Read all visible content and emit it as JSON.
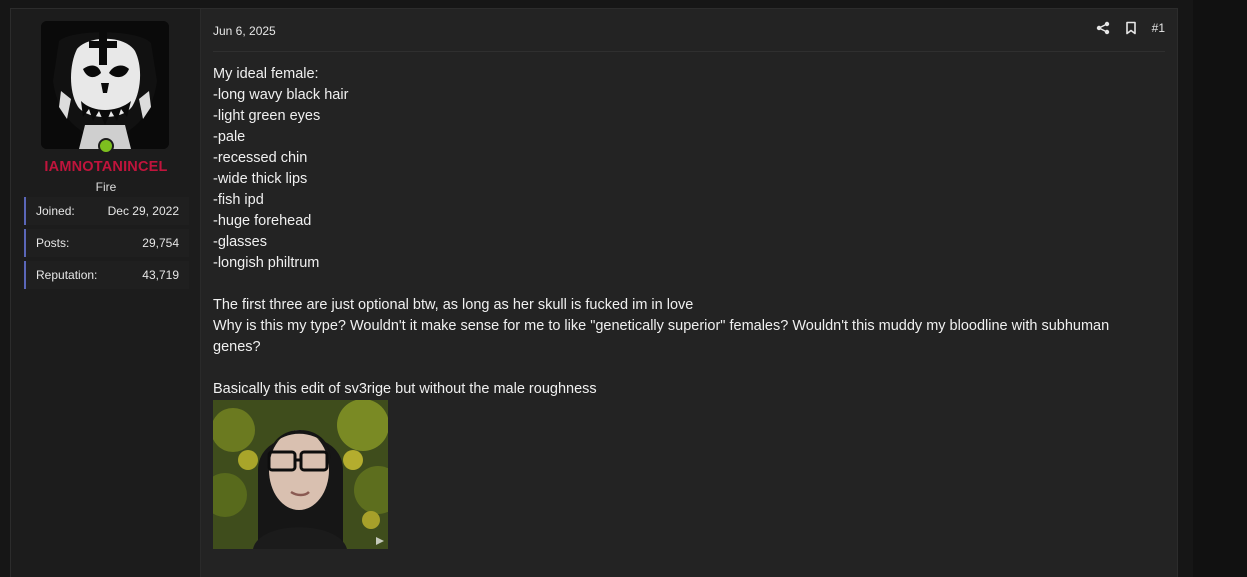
{
  "user": {
    "name": "IAMNOTANINCEL",
    "title": "Fire",
    "stats": [
      {
        "label": "Joined:",
        "value": "Dec 29, 2022"
      },
      {
        "label": "Posts:",
        "value": "29,754"
      },
      {
        "label": "Reputation:",
        "value": "43,719"
      }
    ],
    "status_color": "#7dbf1f",
    "name_color": "#c0143c"
  },
  "post": {
    "date": "Jun 6, 2025",
    "number": "#1",
    "icons": [
      "share-icon",
      "bookmark-icon"
    ],
    "body_lines": [
      "My ideal female:",
      "-long wavy black hair",
      "-light green eyes",
      "-pale",
      "-recessed chin",
      "-wide thick lips",
      "-fish ipd",
      "-huge forehead",
      "-glasses",
      "-longish philtrum",
      "",
      "The first three are just optional btw, as long as her skull is fucked im in love",
      "Why is this my type? Wouldn't it make sense for me to like \"genetically superior\" females? Wouldn't this muddy my bloodline with subhuman",
      "genes?",
      "",
      "Basically this edit of sv3rige but without the male roughness"
    ]
  }
}
